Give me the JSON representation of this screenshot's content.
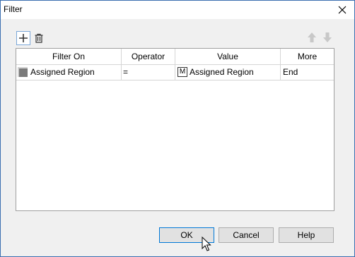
{
  "window": {
    "title": "Filter"
  },
  "toolbar": {
    "add_icon": "plus-icon",
    "delete_icon": "trash-icon",
    "move_up_icon": "arrow-up-icon",
    "move_down_icon": "arrow-down-icon"
  },
  "grid": {
    "columns": [
      "Filter On",
      "Operator",
      "Value",
      "More"
    ],
    "rows": [
      {
        "filter_on": "Assigned Region",
        "operator": "=",
        "value": "Assigned Region",
        "value_icon": "M",
        "more": "End"
      }
    ]
  },
  "buttons": {
    "ok": "OK",
    "cancel": "Cancel",
    "help": "Help"
  },
  "colors": {
    "accent": "#0078d7",
    "border": "#3c6fb0"
  }
}
